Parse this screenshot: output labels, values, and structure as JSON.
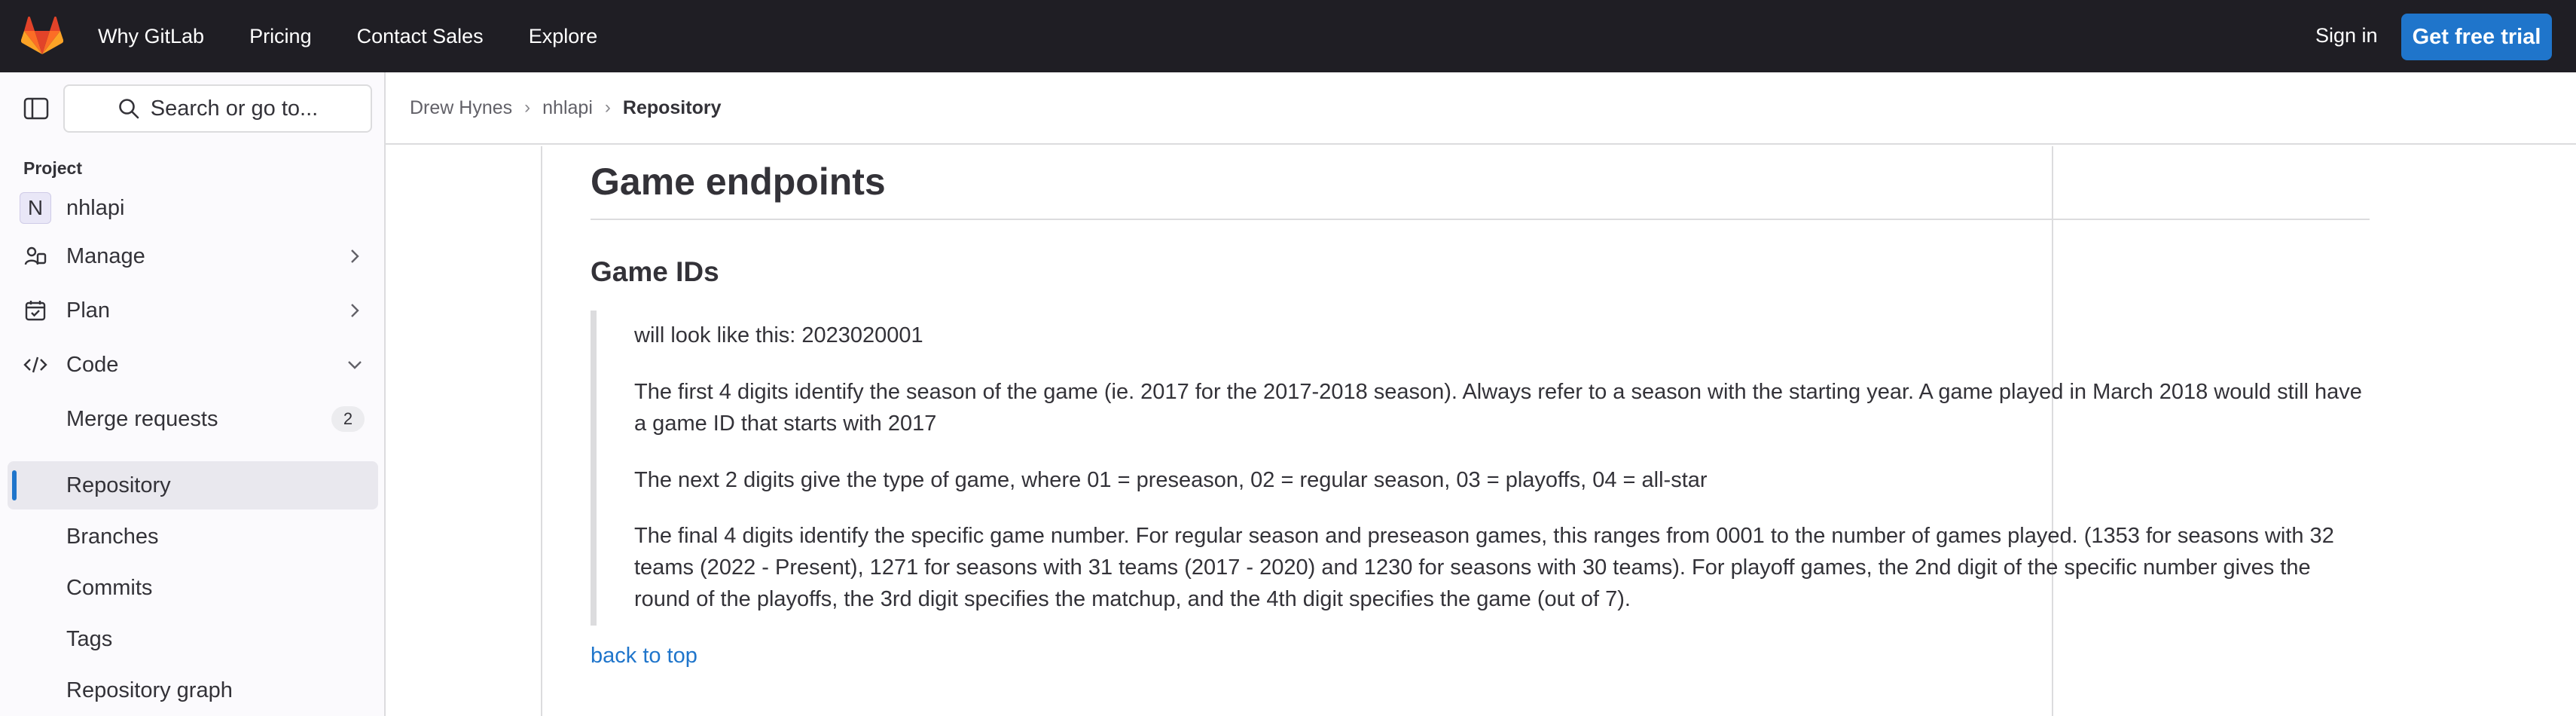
{
  "topbar": {
    "logo_icon": "gitlab-tanuki-logo",
    "nav": [
      "Why GitLab",
      "Pricing",
      "Contact Sales",
      "Explore"
    ],
    "signin_label": "Sign in",
    "trial_label": "Get free trial",
    "bg_color": "#1f1e24",
    "accent_color": "#1f75cb"
  },
  "sidebar": {
    "toggle_icon": "sidebar-toggle-icon",
    "search_placeholder": "Search or go to...",
    "section_label": "Project",
    "project": {
      "avatar_letter": "N",
      "name": "nhlapi"
    },
    "items": [
      {
        "label": "Manage",
        "icon": "users-icon",
        "expanded": false
      },
      {
        "label": "Plan",
        "icon": "calendar-icon",
        "expanded": false
      },
      {
        "label": "Code",
        "icon": "code-icon",
        "expanded": true
      }
    ],
    "code_children": [
      {
        "label": "Merge requests",
        "badge": "2",
        "active": false
      },
      {
        "label": "Repository",
        "active": true
      },
      {
        "label": "Branches",
        "active": false
      },
      {
        "label": "Commits",
        "active": false
      },
      {
        "label": "Tags",
        "active": false
      },
      {
        "label": "Repository graph",
        "active": false
      }
    ]
  },
  "breadcrumb": [
    "Drew Hynes",
    "nhlapi",
    "Repository"
  ],
  "doc": {
    "h1": "Game endpoints",
    "h2": "Game IDs",
    "quote": [
      "will look like this: 2023020001",
      "The first 4 digits identify the season of the game (ie. 2017 for the 2017-2018 season). Always refer to a season with the starting year. A game played in March 2018 would still have a game ID that starts with 2017",
      "The next 2 digits give the type of game, where 01 = preseason, 02 = regular season, 03 = playoffs, 04 = all-star",
      "The final 4 digits identify the specific game number. For regular season and preseason games, this ranges from 0001 to the number of games played. (1353 for seasons with 32 teams (2022 - Present), 1271 for seasons with 31 teams (2017 - 2020) and 1230 for seasons with 30 teams). For playoff games, the 2nd digit of the specific number gives the round of the playoffs, the 3rd digit specifies the matchup, and the 4th digit specifies the game (out of 7)."
    ],
    "back_link": "back to top"
  }
}
